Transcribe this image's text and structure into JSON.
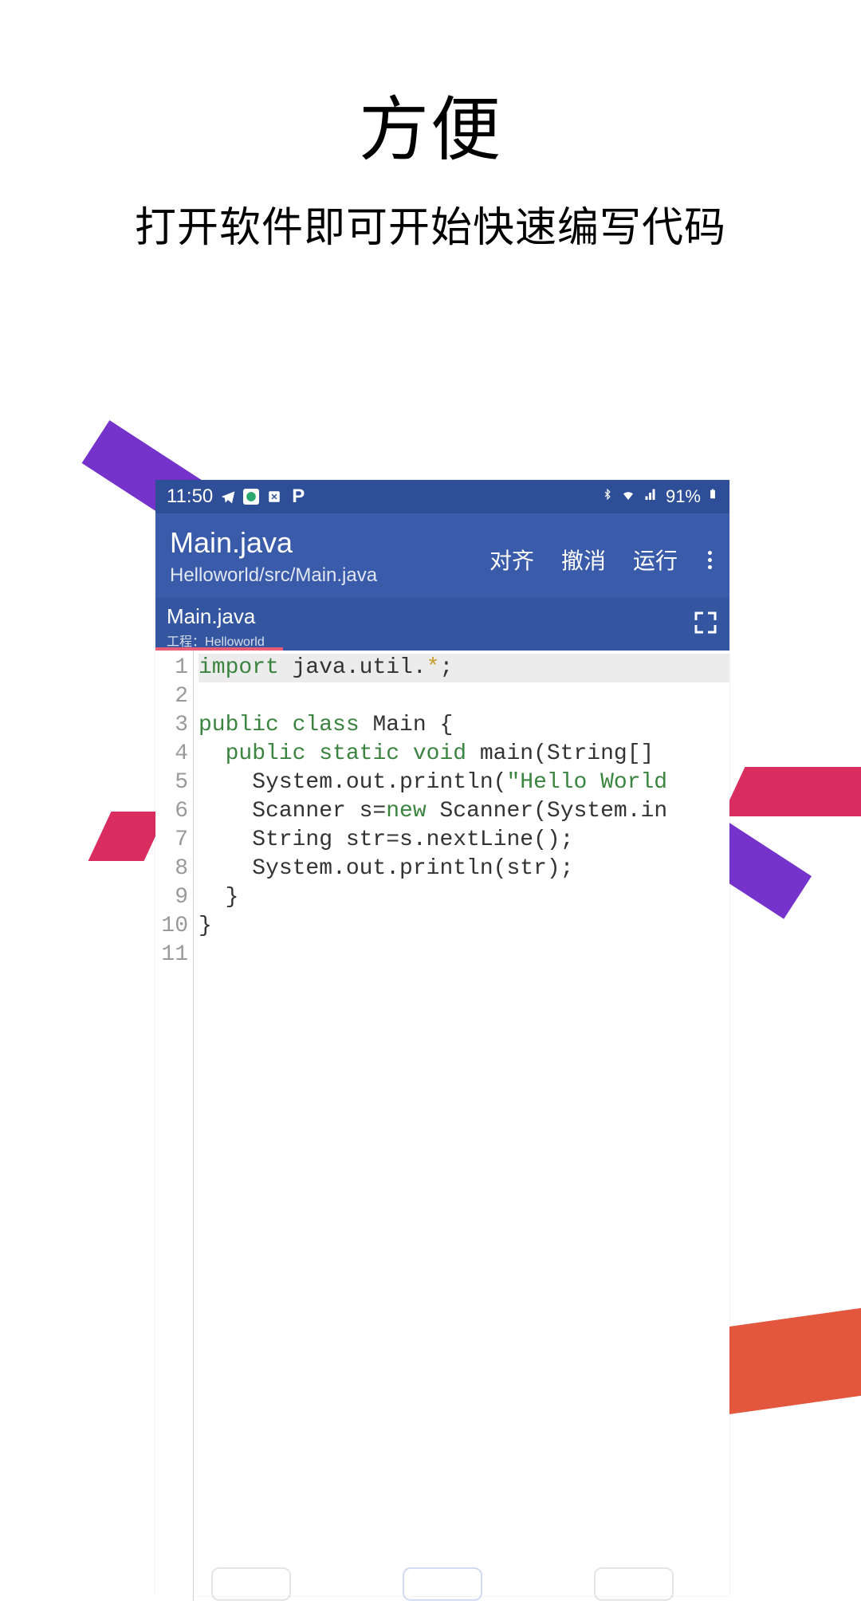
{
  "promo": {
    "title": "方便",
    "subtitle": "打开软件即可开始快速编写代码"
  },
  "status_bar": {
    "time": "11:50",
    "battery_text": "91%"
  },
  "app_bar": {
    "title": "Main.java",
    "path": "Helloworld/src/Main.java",
    "actions": {
      "align": "对齐",
      "undo": "撤消",
      "run": "运行"
    }
  },
  "tab": {
    "title": "Main.java",
    "project_prefix": "工程：",
    "project_name": "Helloworld"
  },
  "editor": {
    "line_numbers": [
      "1",
      "2",
      "3",
      "4",
      "5",
      "6",
      "7",
      "8",
      "9",
      "10",
      "11"
    ],
    "lines": [
      {
        "segments": [
          {
            "t": "import",
            "c": "kw"
          },
          {
            "t": " java.util.",
            "c": "txt"
          },
          {
            "t": "*",
            "c": "wild"
          },
          {
            "t": ";",
            "c": "txt"
          }
        ],
        "hl": true
      },
      {
        "segments": []
      },
      {
        "segments": [
          {
            "t": "public class",
            "c": "kw"
          },
          {
            "t": " Main {",
            "c": "txt"
          }
        ]
      },
      {
        "segments": [
          {
            "t": "  ",
            "c": "txt"
          },
          {
            "t": "public static void",
            "c": "kw"
          },
          {
            "t": " main(String[]",
            "c": "txt"
          }
        ]
      },
      {
        "segments": [
          {
            "t": "    System.out.println(",
            "c": "txt"
          },
          {
            "t": "\"Hello World",
            "c": "str"
          }
        ]
      },
      {
        "segments": [
          {
            "t": "    Scanner s=",
            "c": "txt"
          },
          {
            "t": "new",
            "c": "kw"
          },
          {
            "t": " Scanner(System.in",
            "c": "txt"
          }
        ]
      },
      {
        "segments": [
          {
            "t": "    String str=s.nextLine();",
            "c": "txt"
          }
        ]
      },
      {
        "segments": [
          {
            "t": "    System.out.println(str);",
            "c": "txt"
          }
        ]
      },
      {
        "segments": [
          {
            "t": "  }",
            "c": "txt"
          }
        ]
      },
      {
        "segments": [
          {
            "t": "}",
            "c": "txt"
          }
        ]
      },
      {
        "segments": []
      }
    ]
  }
}
